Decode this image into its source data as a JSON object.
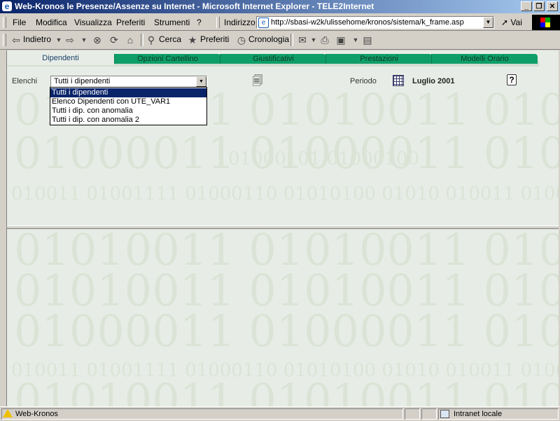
{
  "window": {
    "title": "Web-Kronos le Presenze/Assenze su Internet - Microsoft Internet Explorer - TELE2Internet",
    "buttons": {
      "minimize": "_",
      "maximize": "❐",
      "close": "✕"
    }
  },
  "menu": {
    "items": [
      "File",
      "Modifica",
      "Visualizza",
      "Preferiti",
      "Strumenti",
      "?"
    ],
    "address_label": "Indirizzo",
    "address_url": "http://sbasi-w2k/ulissehome/kronos/sistema/k_frame.asp",
    "go_label": "Vai"
  },
  "toolbar": {
    "back_label": "Indietro",
    "search_label": "Cerca",
    "favorites_label": "Preferiti",
    "history_label": "Cronologia"
  },
  "tabs": [
    {
      "label": "Dipendenti",
      "active": true
    },
    {
      "label": "Opzioni Cartellino",
      "active": false
    },
    {
      "label": "Giustificativi",
      "active": false
    },
    {
      "label": "Prestazioni",
      "active": false
    },
    {
      "label": "Modelli Orario",
      "active": false
    }
  ],
  "filters": {
    "lists_label": "Elenchi",
    "selected": "Tutti i dipendenti",
    "options": [
      "Tutti i dipendenti",
      "Elenco Dipendenti con UTE_VAR1",
      "Tutti i dip. con anomalia",
      "Tutti i dip. con anomalia 2"
    ],
    "period_label": "Periodo",
    "period_value": "Luglio 2001"
  },
  "background": {
    "binary_big_a": "01010011 01010011 01010",
    "binary_big_b": "01000011 01000011 01000",
    "binary_small": "01000101 01000100",
    "binary_row": "010011 01001111 01000110 01010100 01010 010011 01001111"
  },
  "status": {
    "text": "Web-Kronos",
    "zone": "Intranet locale"
  },
  "colors": {
    "tab_green": "#0f9e68",
    "content_bg": "#e7ede6",
    "selection": "#0a246a"
  }
}
